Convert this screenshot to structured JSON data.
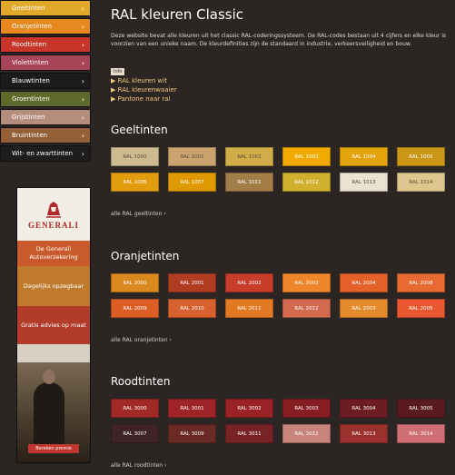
{
  "sidebar": {
    "items": [
      {
        "label": "Geeltinten",
        "bg": "#e1a92a"
      },
      {
        "label": "Oranjetinten",
        "bg": "#e7891f"
      },
      {
        "label": "Roodtinten",
        "bg": "#c8362a"
      },
      {
        "label": "Violettinten",
        "bg": "#a84458"
      },
      {
        "label": "Blauwtinten",
        "bg": "#1c1c1c"
      },
      {
        "label": "Groentinten",
        "bg": "#5e6a2a"
      },
      {
        "label": "Grijstinten",
        "bg": "#b58d7d"
      },
      {
        "label": "Bruintinten",
        "bg": "#955f38"
      },
      {
        "label": "Wit- en zwarttinten",
        "bg": "#1d1d1d"
      }
    ]
  },
  "ad": {
    "brand": "GENERALI",
    "blocks": [
      {
        "text": "De Generali Autoverzekering",
        "bg": "#c95a2c"
      },
      {
        "text": "Dagelijks opzegbaar",
        "bg": "#c07a2c"
      },
      {
        "text": "Gratis advies op maat",
        "bg": "#b23b2a"
      }
    ],
    "button": "Bereken premie"
  },
  "main": {
    "title": "RAL kleuren Classic",
    "intro": "Deze website bevat alle kleuren uit het classic RAL-coderingssysteem. De RAL-codes bestaan uit 4 cijfers en elke kleur is voorzien van een unieke naam. De kleurdefinities zijn de standaard in industrie, verkeersveiligheid en bouw.",
    "info": "Info",
    "links": [
      "RAL kleuren wit",
      "RAL kleurenwaaier",
      "Pantone naar ral"
    ]
  },
  "sections": [
    {
      "title": "Geeltinten",
      "more": "alle RAL geeltinten",
      "swatches": [
        {
          "label": "RAL 1000",
          "bg": "#cdbb8f",
          "dark": true
        },
        {
          "label": "RAL 1001",
          "bg": "#c9a46f",
          "dark": true
        },
        {
          "label": "RAL 1002",
          "bg": "#d1ad4a",
          "dark": true
        },
        {
          "label": "RAL 1003",
          "bg": "#f1aa00",
          "dark": false
        },
        {
          "label": "RAL 1004",
          "bg": "#e3a40d",
          "dark": false
        },
        {
          "label": "RAL 1005",
          "bg": "#c99713",
          "dark": false
        },
        {
          "label": "RAL 1006",
          "bg": "#e19d0e",
          "dark": false
        },
        {
          "label": "RAL 1007",
          "bg": "#de9a00",
          "dark": false
        },
        {
          "label": "RAL 1011",
          "bg": "#a27d48",
          "dark": false
        },
        {
          "label": "RAL 1012",
          "bg": "#d1b02f",
          "dark": false
        },
        {
          "label": "RAL 1013",
          "bg": "#ebe2d0",
          "dark": true
        },
        {
          "label": "RAL 1014",
          "bg": "#dec78e",
          "dark": true
        }
      ]
    },
    {
      "title": "Oranjetinten",
      "more": "alle RAL oranjetinten",
      "swatches": [
        {
          "label": "RAL 2000",
          "bg": "#d9891e",
          "dark": false
        },
        {
          "label": "RAL 2001",
          "bg": "#b03c22",
          "dark": false
        },
        {
          "label": "RAL 2002",
          "bg": "#c73d2a",
          "dark": false
        },
        {
          "label": "RAL 2003",
          "bg": "#ef862b",
          "dark": false
        },
        {
          "label": "RAL 2004",
          "bg": "#e4622a",
          "dark": false
        },
        {
          "label": "RAL 2008",
          "bg": "#e76a33",
          "dark": false
        },
        {
          "label": "RAL 2009",
          "bg": "#dc5e26",
          "dark": false
        },
        {
          "label": "RAL 2010",
          "bg": "#d6602e",
          "dark": false
        },
        {
          "label": "RAL 2011",
          "bg": "#e47923",
          "dark": false
        },
        {
          "label": "RAL 2012",
          "bg": "#d36a4f",
          "dark": false
        },
        {
          "label": "RAL 2003",
          "bg": "#e38a2d",
          "dark": false
        },
        {
          "label": "RAL 2005",
          "bg": "#e95730",
          "dark": false
        }
      ]
    },
    {
      "title": "Roodtinten",
      "more": "alle RAL roodtinten",
      "swatches": [
        {
          "label": "RAL 3000",
          "bg": "#a22a26",
          "dark": false
        },
        {
          "label": "RAL 3001",
          "bg": "#9e2428",
          "dark": false
        },
        {
          "label": "RAL 3002",
          "bg": "#9a2226",
          "dark": false
        },
        {
          "label": "RAL 3003",
          "bg": "#861d22",
          "dark": false
        },
        {
          "label": "RAL 3004",
          "bg": "#6d1d22",
          "dark": false
        },
        {
          "label": "RAL 3005",
          "bg": "#5a1b1f",
          "dark": false
        },
        {
          "label": "RAL 3007",
          "bg": "#3f2326",
          "dark": false
        },
        {
          "label": "RAL 3009",
          "bg": "#6b2a23",
          "dark": false
        },
        {
          "label": "RAL 3011",
          "bg": "#7a2327",
          "dark": false
        },
        {
          "label": "RAL 3012",
          "bg": "#c7837c",
          "dark": false
        },
        {
          "label": "RAL 3013",
          "bg": "#9a312c",
          "dark": false
        },
        {
          "label": "RAL 3014",
          "bg": "#cf6e73",
          "dark": false
        }
      ]
    }
  ]
}
